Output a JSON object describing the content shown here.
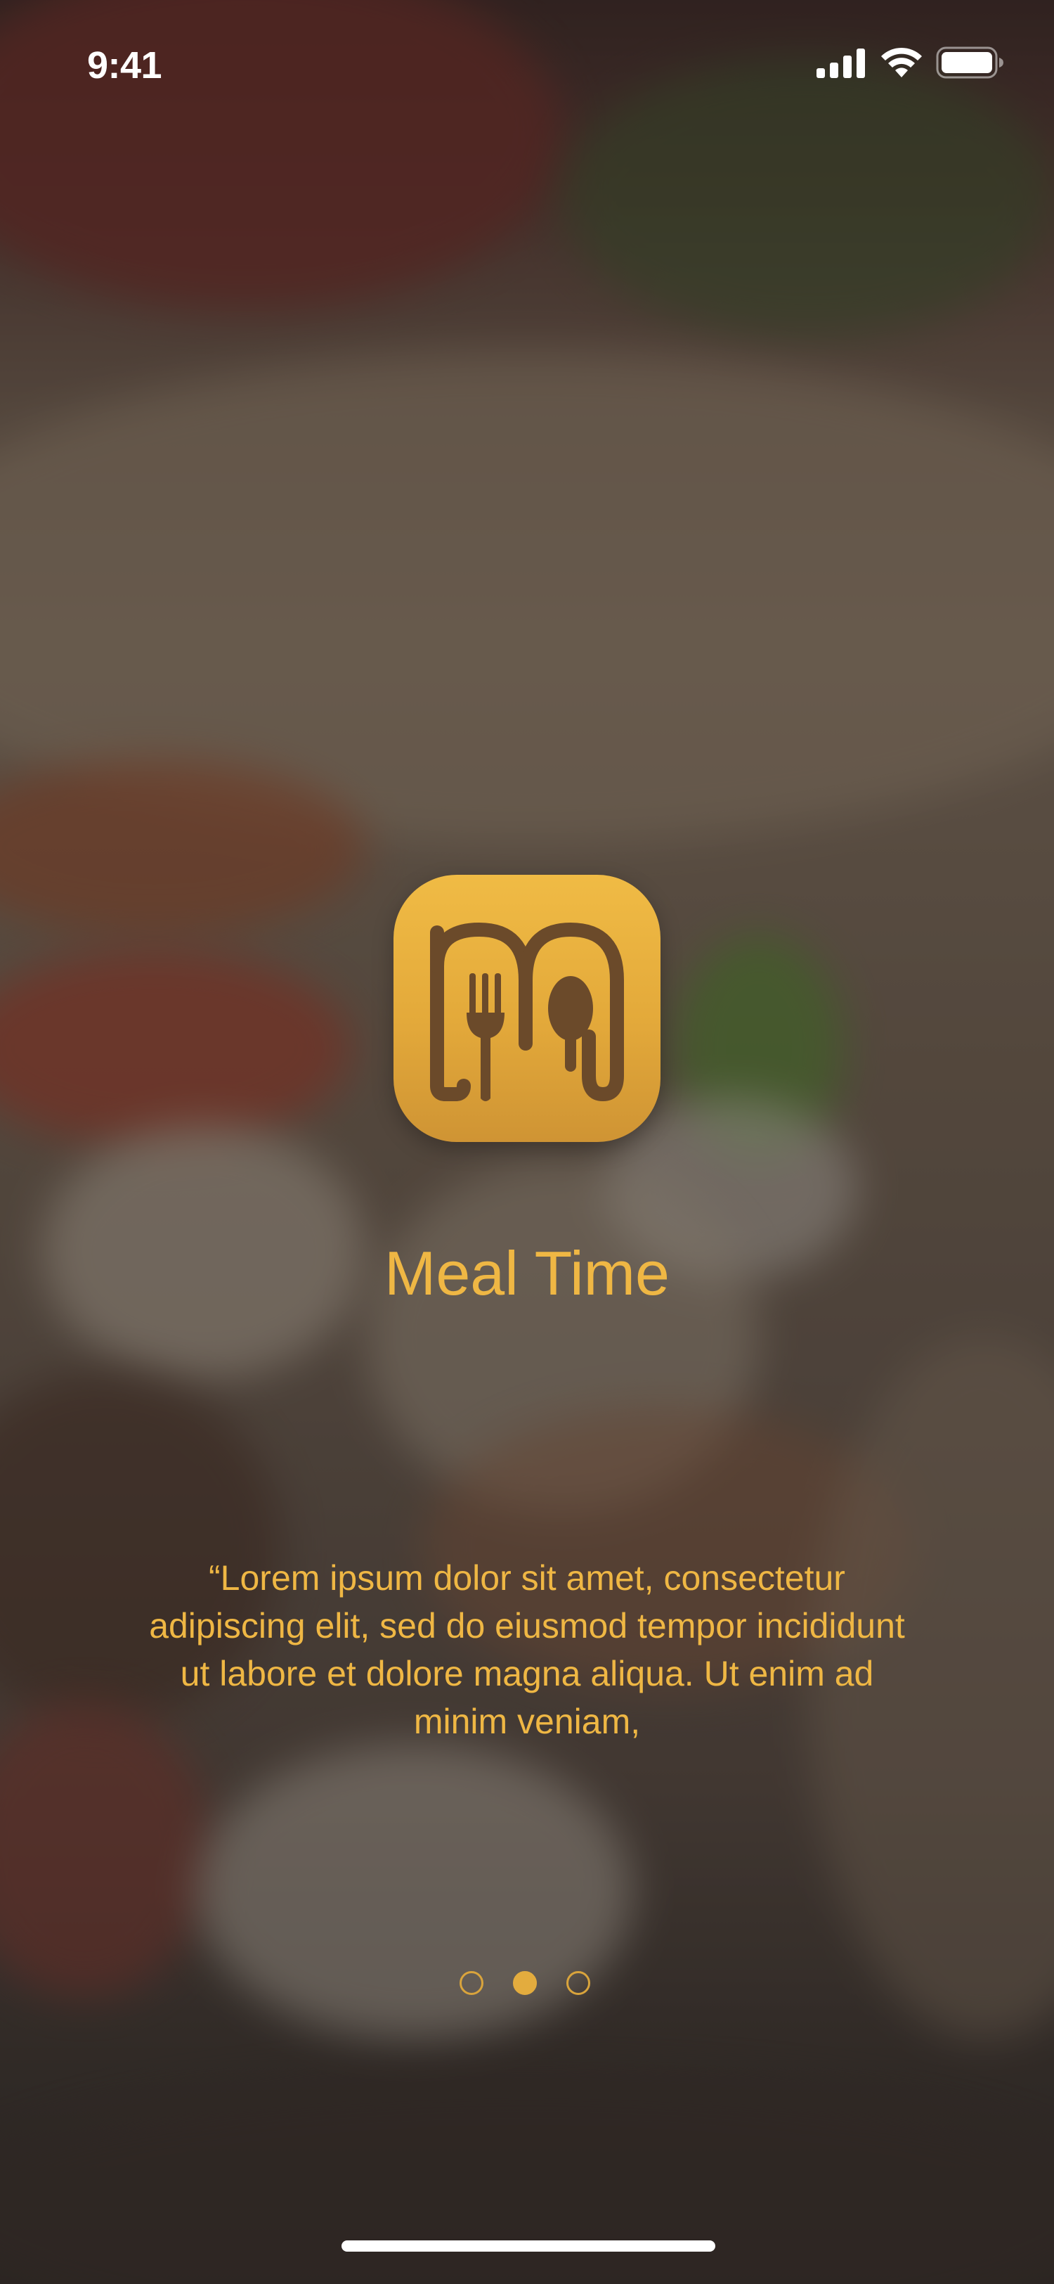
{
  "status_bar": {
    "time": "9:41",
    "icons": [
      "cellular-signal-icon",
      "wifi-icon",
      "battery-icon"
    ]
  },
  "app": {
    "name": "Meal Time",
    "logo_icon": "fork-spoon-m-logo-icon",
    "tagline": "“Lorem ipsum dolor sit amet, consectetur adipiscing elit, sed do eiusmod tempor incididunt ut labore et dolore magna aliqua. Ut enim ad minim veniam,"
  },
  "pager": {
    "total_pages": 3,
    "current_page": 2
  },
  "colors": {
    "accent": "#efb744",
    "logo_gradient_top": "#f0bb45",
    "logo_gradient_bottom": "#cf9434",
    "logo_glyph": "#6b4a2a",
    "status_text": "#ffffff"
  }
}
